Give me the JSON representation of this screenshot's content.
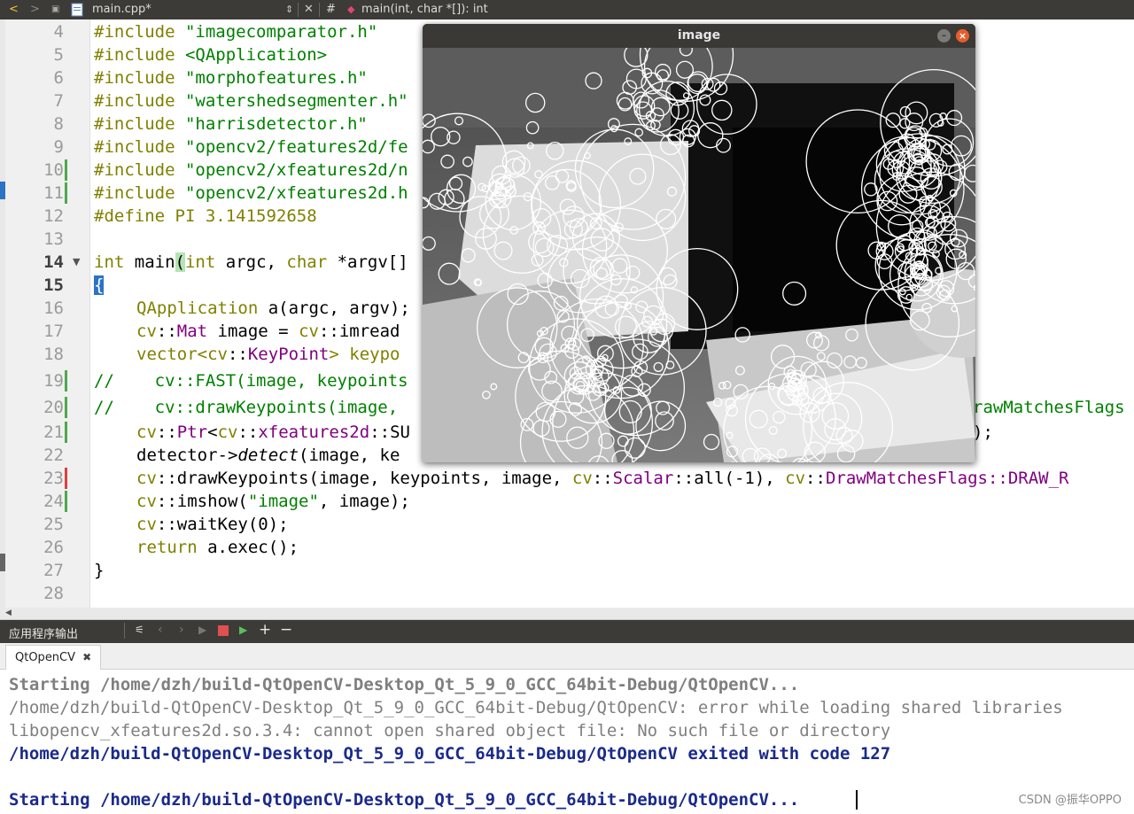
{
  "toolbar": {
    "back": "<",
    "forward": ">",
    "file_name": "main.cpp*",
    "close": "✕",
    "hash": "#",
    "symbol": "main(int, char *[]): int"
  },
  "editor": {
    "line_numbers": [
      "4",
      "5",
      "6",
      "7",
      "8",
      "9",
      "10",
      "11",
      "12",
      "13",
      "14",
      "15",
      "16",
      "17",
      "18",
      "19",
      "20",
      "21",
      "22",
      "23",
      "24",
      "25",
      "26",
      "27",
      "28"
    ],
    "lines": {
      "l4": {
        "a": "#include ",
        "b": "\"imagecomparator.h\""
      },
      "l5": {
        "a": "#include ",
        "b": "<QApplication>"
      },
      "l6": {
        "a": "#include ",
        "b": "\"morphofeatures.h\""
      },
      "l7": {
        "a": "#include ",
        "b": "\"watershedsegmenter.h\""
      },
      "l8": {
        "a": "#include ",
        "b": "\"harrisdetector.h\""
      },
      "l9": {
        "a": "#include ",
        "b": "\"opencv2/features2d/fe"
      },
      "l10": {
        "a": "#include ",
        "b": "\"opencv2/xfeatures2d/n"
      },
      "l11": {
        "a": "#include ",
        "b": "\"opencv2/xfeatures2d.h"
      },
      "l12": {
        "a": "#define PI 3.141592658"
      },
      "l14": {
        "kw1": "int",
        "a": " main",
        "p": "(",
        "kw2": "int",
        "b": " argc, ",
        "kw3": "char",
        "c": " *argv[]"
      },
      "l15": {
        "a": "{"
      },
      "l16": {
        "a": "QApplication",
        "b": " a(argc, argv);"
      },
      "l17": {
        "a": "cv",
        "b": "::",
        "c": "Mat",
        "d": " image = ",
        "e": "cv",
        "f": "::imread"
      },
      "l18": {
        "a": "vector<",
        "b": "cv",
        "c": "::",
        "d": "KeyPoint",
        "e": "> keypo"
      },
      "l19": {
        "a": "//    cv::FAST(image, keypoints"
      },
      "l20": {
        "a": "//    cv::drawKeypoints(image, ",
        "b": "rawMatchesFlags"
      },
      "l21": {
        "a": "cv",
        "b": "::",
        "c": "Ptr",
        "d": "<",
        "e": "cv",
        "f": "::",
        "g": "xfeatures2d",
        "h": "::SU",
        "i": ");"
      },
      "l22": {
        "a": "detector->",
        "b": "detect",
        "c": "(image, ke"
      },
      "l23": {
        "a": "cv",
        "b": "::drawKeypoints(image, keypoints, image, ",
        "c": "cv",
        "d": "::",
        "e": "Scalar",
        "f": "::all(-1), ",
        "g": "cv",
        "h": "::",
        "i": "DrawMatchesFlags",
        "j": "::DRAW_R"
      },
      "l24": {
        "a": "cv",
        "b": "::imshow(",
        "c": "\"image\"",
        "d": ", image);"
      },
      "l25": {
        "a": "cv",
        "b": "::waitKey(0);"
      },
      "l26": {
        "a": "return",
        "b": " a.exec();"
      },
      "l27": {
        "a": "}"
      }
    }
  },
  "image_window": {
    "title": "image",
    "minimize": "–",
    "close": "×"
  },
  "output_pane": {
    "title": "应用程序输出",
    "tab_label": "QtOpenCV",
    "tab_close": "✖",
    "lines": [
      "Starting /home/dzh/build-QtOpenCV-Desktop_Qt_5_9_0_GCC_64bit-Debug/QtOpenCV...",
      "/home/dzh/build-QtOpenCV-Desktop_Qt_5_9_0_GCC_64bit-Debug/QtOpenCV: error while loading shared libraries",
      "libopencv_xfeatures2d.so.3.4: cannot open shared object file: No such file or directory",
      "/home/dzh/build-QtOpenCV-Desktop_Qt_5_9_0_GCC_64bit-Debug/QtOpenCV exited with code 127",
      "Starting /home/dzh/build-QtOpenCV-Desktop_Qt_5_9_0_GCC_64bit-Debug/QtOpenCV..."
    ]
  },
  "watermark": "CSDN @振华OPPO",
  "colors": {
    "keyword": "#808000",
    "string": "#008000",
    "type": "#800080",
    "comment": "#008000",
    "output_blue": "#1a2a8c",
    "toolbar_bg": "#3c3b37",
    "close_btn": "#e65e2b"
  }
}
